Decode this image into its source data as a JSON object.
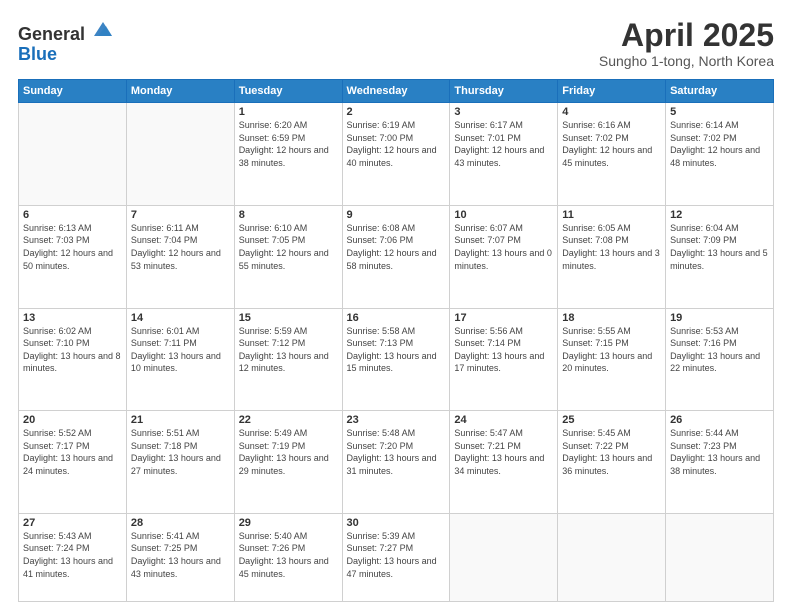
{
  "header": {
    "logo_general": "General",
    "logo_blue": "Blue",
    "title": "April 2025",
    "location": "Sungho 1-tong, North Korea"
  },
  "weekdays": [
    "Sunday",
    "Monday",
    "Tuesday",
    "Wednesday",
    "Thursday",
    "Friday",
    "Saturday"
  ],
  "days": [
    {
      "num": "",
      "detail": ""
    },
    {
      "num": "",
      "detail": ""
    },
    {
      "num": "1",
      "sunrise": "Sunrise: 6:20 AM",
      "sunset": "Sunset: 6:59 PM",
      "daylight": "Daylight: 12 hours and 38 minutes."
    },
    {
      "num": "2",
      "sunrise": "Sunrise: 6:19 AM",
      "sunset": "Sunset: 7:00 PM",
      "daylight": "Daylight: 12 hours and 40 minutes."
    },
    {
      "num": "3",
      "sunrise": "Sunrise: 6:17 AM",
      "sunset": "Sunset: 7:01 PM",
      "daylight": "Daylight: 12 hours and 43 minutes."
    },
    {
      "num": "4",
      "sunrise": "Sunrise: 6:16 AM",
      "sunset": "Sunset: 7:02 PM",
      "daylight": "Daylight: 12 hours and 45 minutes."
    },
    {
      "num": "5",
      "sunrise": "Sunrise: 6:14 AM",
      "sunset": "Sunset: 7:02 PM",
      "daylight": "Daylight: 12 hours and 48 minutes."
    },
    {
      "num": "6",
      "sunrise": "Sunrise: 6:13 AM",
      "sunset": "Sunset: 7:03 PM",
      "daylight": "Daylight: 12 hours and 50 minutes."
    },
    {
      "num": "7",
      "sunrise": "Sunrise: 6:11 AM",
      "sunset": "Sunset: 7:04 PM",
      "daylight": "Daylight: 12 hours and 53 minutes."
    },
    {
      "num": "8",
      "sunrise": "Sunrise: 6:10 AM",
      "sunset": "Sunset: 7:05 PM",
      "daylight": "Daylight: 12 hours and 55 minutes."
    },
    {
      "num": "9",
      "sunrise": "Sunrise: 6:08 AM",
      "sunset": "Sunset: 7:06 PM",
      "daylight": "Daylight: 12 hours and 58 minutes."
    },
    {
      "num": "10",
      "sunrise": "Sunrise: 6:07 AM",
      "sunset": "Sunset: 7:07 PM",
      "daylight": "Daylight: 13 hours and 0 minutes."
    },
    {
      "num": "11",
      "sunrise": "Sunrise: 6:05 AM",
      "sunset": "Sunset: 7:08 PM",
      "daylight": "Daylight: 13 hours and 3 minutes."
    },
    {
      "num": "12",
      "sunrise": "Sunrise: 6:04 AM",
      "sunset": "Sunset: 7:09 PM",
      "daylight": "Daylight: 13 hours and 5 minutes."
    },
    {
      "num": "13",
      "sunrise": "Sunrise: 6:02 AM",
      "sunset": "Sunset: 7:10 PM",
      "daylight": "Daylight: 13 hours and 8 minutes."
    },
    {
      "num": "14",
      "sunrise": "Sunrise: 6:01 AM",
      "sunset": "Sunset: 7:11 PM",
      "daylight": "Daylight: 13 hours and 10 minutes."
    },
    {
      "num": "15",
      "sunrise": "Sunrise: 5:59 AM",
      "sunset": "Sunset: 7:12 PM",
      "daylight": "Daylight: 13 hours and 12 minutes."
    },
    {
      "num": "16",
      "sunrise": "Sunrise: 5:58 AM",
      "sunset": "Sunset: 7:13 PM",
      "daylight": "Daylight: 13 hours and 15 minutes."
    },
    {
      "num": "17",
      "sunrise": "Sunrise: 5:56 AM",
      "sunset": "Sunset: 7:14 PM",
      "daylight": "Daylight: 13 hours and 17 minutes."
    },
    {
      "num": "18",
      "sunrise": "Sunrise: 5:55 AM",
      "sunset": "Sunset: 7:15 PM",
      "daylight": "Daylight: 13 hours and 20 minutes."
    },
    {
      "num": "19",
      "sunrise": "Sunrise: 5:53 AM",
      "sunset": "Sunset: 7:16 PM",
      "daylight": "Daylight: 13 hours and 22 minutes."
    },
    {
      "num": "20",
      "sunrise": "Sunrise: 5:52 AM",
      "sunset": "Sunset: 7:17 PM",
      "daylight": "Daylight: 13 hours and 24 minutes."
    },
    {
      "num": "21",
      "sunrise": "Sunrise: 5:51 AM",
      "sunset": "Sunset: 7:18 PM",
      "daylight": "Daylight: 13 hours and 27 minutes."
    },
    {
      "num": "22",
      "sunrise": "Sunrise: 5:49 AM",
      "sunset": "Sunset: 7:19 PM",
      "daylight": "Daylight: 13 hours and 29 minutes."
    },
    {
      "num": "23",
      "sunrise": "Sunrise: 5:48 AM",
      "sunset": "Sunset: 7:20 PM",
      "daylight": "Daylight: 13 hours and 31 minutes."
    },
    {
      "num": "24",
      "sunrise": "Sunrise: 5:47 AM",
      "sunset": "Sunset: 7:21 PM",
      "daylight": "Daylight: 13 hours and 34 minutes."
    },
    {
      "num": "25",
      "sunrise": "Sunrise: 5:45 AM",
      "sunset": "Sunset: 7:22 PM",
      "daylight": "Daylight: 13 hours and 36 minutes."
    },
    {
      "num": "26",
      "sunrise": "Sunrise: 5:44 AM",
      "sunset": "Sunset: 7:23 PM",
      "daylight": "Daylight: 13 hours and 38 minutes."
    },
    {
      "num": "27",
      "sunrise": "Sunrise: 5:43 AM",
      "sunset": "Sunset: 7:24 PM",
      "daylight": "Daylight: 13 hours and 41 minutes."
    },
    {
      "num": "28",
      "sunrise": "Sunrise: 5:41 AM",
      "sunset": "Sunset: 7:25 PM",
      "daylight": "Daylight: 13 hours and 43 minutes."
    },
    {
      "num": "29",
      "sunrise": "Sunrise: 5:40 AM",
      "sunset": "Sunset: 7:26 PM",
      "daylight": "Daylight: 13 hours and 45 minutes."
    },
    {
      "num": "30",
      "sunrise": "Sunrise: 5:39 AM",
      "sunset": "Sunset: 7:27 PM",
      "daylight": "Daylight: 13 hours and 47 minutes."
    },
    {
      "num": "",
      "detail": ""
    },
    {
      "num": "",
      "detail": ""
    },
    {
      "num": "",
      "detail": ""
    }
  ]
}
